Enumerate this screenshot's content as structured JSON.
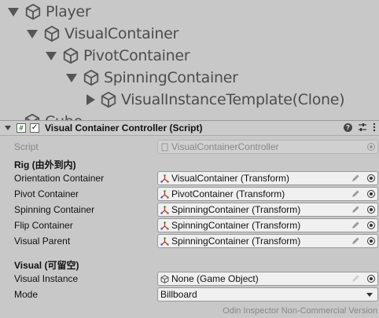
{
  "hierarchy": {
    "items": [
      {
        "label": "Player",
        "expanded": true
      },
      {
        "label": "VisualContainer",
        "expanded": true
      },
      {
        "label": "PivotContainer",
        "expanded": true
      },
      {
        "label": "SpinningContainer",
        "expanded": true
      },
      {
        "label": "VisualInstanceTemplate(Clone)",
        "expanded": false
      },
      {
        "label": "Cube",
        "expanded": false
      }
    ]
  },
  "component": {
    "title": "Visual Container Controller (Script)",
    "icons": [
      "help-icon",
      "preset-icon",
      "kebab-menu-icon"
    ]
  },
  "inspector": {
    "script": {
      "label": "Script",
      "value": "VisualContainerController"
    },
    "rig_section": "Rig (由外到内)",
    "rig_fields": [
      {
        "label": "Orientation Container",
        "value": "VisualContainer (Transform)"
      },
      {
        "label": "Pivot Container",
        "value": "PivotContainer (Transform)"
      },
      {
        "label": "Spinning Container",
        "value": "SpinningContainer (Transform)"
      },
      {
        "label": "Flip Container",
        "value": "SpinningContainer (Transform)"
      },
      {
        "label": "Visual Parent",
        "value": "SpinningContainer (Transform)"
      }
    ],
    "visual_section": "Visual (可留空)",
    "visual_instance": {
      "label": "Visual Instance",
      "value": "None (Game Object)"
    },
    "mode": {
      "label": "Mode",
      "value": "Billboard"
    }
  },
  "footer": "Odin Inspector Non-Commercial Version"
}
